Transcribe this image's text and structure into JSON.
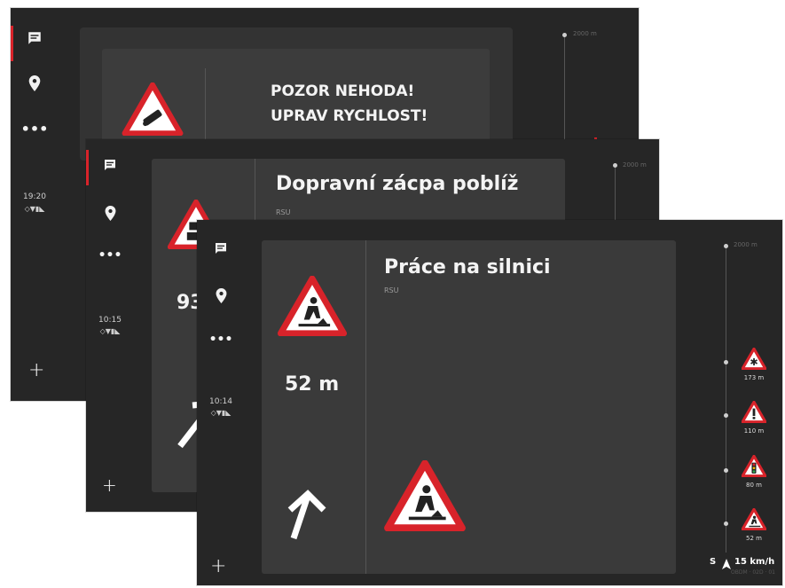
{
  "screen1": {
    "time": "19:20",
    "status": "◇▼▮◣",
    "alert_line1": "POZOR NEHODA!",
    "alert_line2": "UPRAV RYCHLOST!",
    "timeline_top": "2000 m",
    "sign_icon": "accident-warning-sign-icon"
  },
  "screen2": {
    "time": "10:15",
    "status": "◇▼▮◣",
    "title": "Dopravní zácpa poblíž",
    "source": "RSU",
    "distance_partial": "93",
    "timeline_top": "2000 m",
    "sign_icon": "traffic-jam-sign-icon"
  },
  "screen3": {
    "time": "10:14",
    "status": "◇▼▮◣",
    "title": "Práce na silnici",
    "source": "RSU",
    "distance": "52 m",
    "timeline_top": "2000 m",
    "timeline_items": [
      {
        "label": "173 m",
        "icon": "snow-ice-warning-sign-icon"
      },
      {
        "label": "110 m",
        "icon": "general-danger-sign-icon"
      },
      {
        "label": "80 m",
        "icon": "traffic-lights-sign-icon"
      },
      {
        "label": "52 m",
        "icon": "road-works-sign-icon"
      }
    ],
    "heading": "S",
    "speed": "15 km/h",
    "footer_faint": "OBDM · 02D · 01"
  },
  "colors": {
    "accent": "#d8232a",
    "background": "#262626",
    "card": "#3a3a3a"
  }
}
